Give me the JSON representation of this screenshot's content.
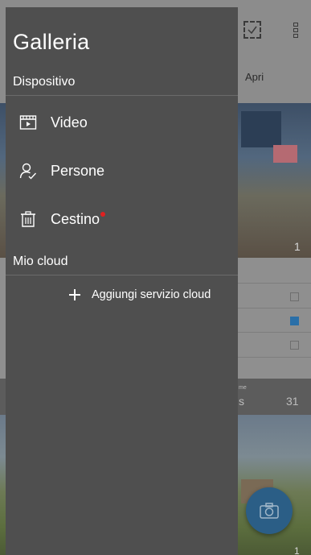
{
  "background": {
    "tab_label": "Apri",
    "photo1_count": "1",
    "album_caption_small": "me",
    "album_name_fragment": "s",
    "album_count": "31",
    "photo2_count": "1",
    "checkbox_states": [
      false,
      true,
      false
    ]
  },
  "drawer": {
    "title": "Galleria",
    "sections": {
      "device": "Dispositivo",
      "cloud": "Mio cloud"
    },
    "items": [
      {
        "label": "Video",
        "icon": "video-icon"
      },
      {
        "label": "Persone",
        "icon": "people-icon"
      },
      {
        "label": "Cestino",
        "icon": "trash-icon",
        "badge": true
      }
    ],
    "add_cloud_label": "Aggiungi servizio cloud"
  },
  "colors": {
    "drawer_bg": "#4f4f4f",
    "badge_red": "#e02020",
    "fab_blue": "#2b5e86"
  }
}
